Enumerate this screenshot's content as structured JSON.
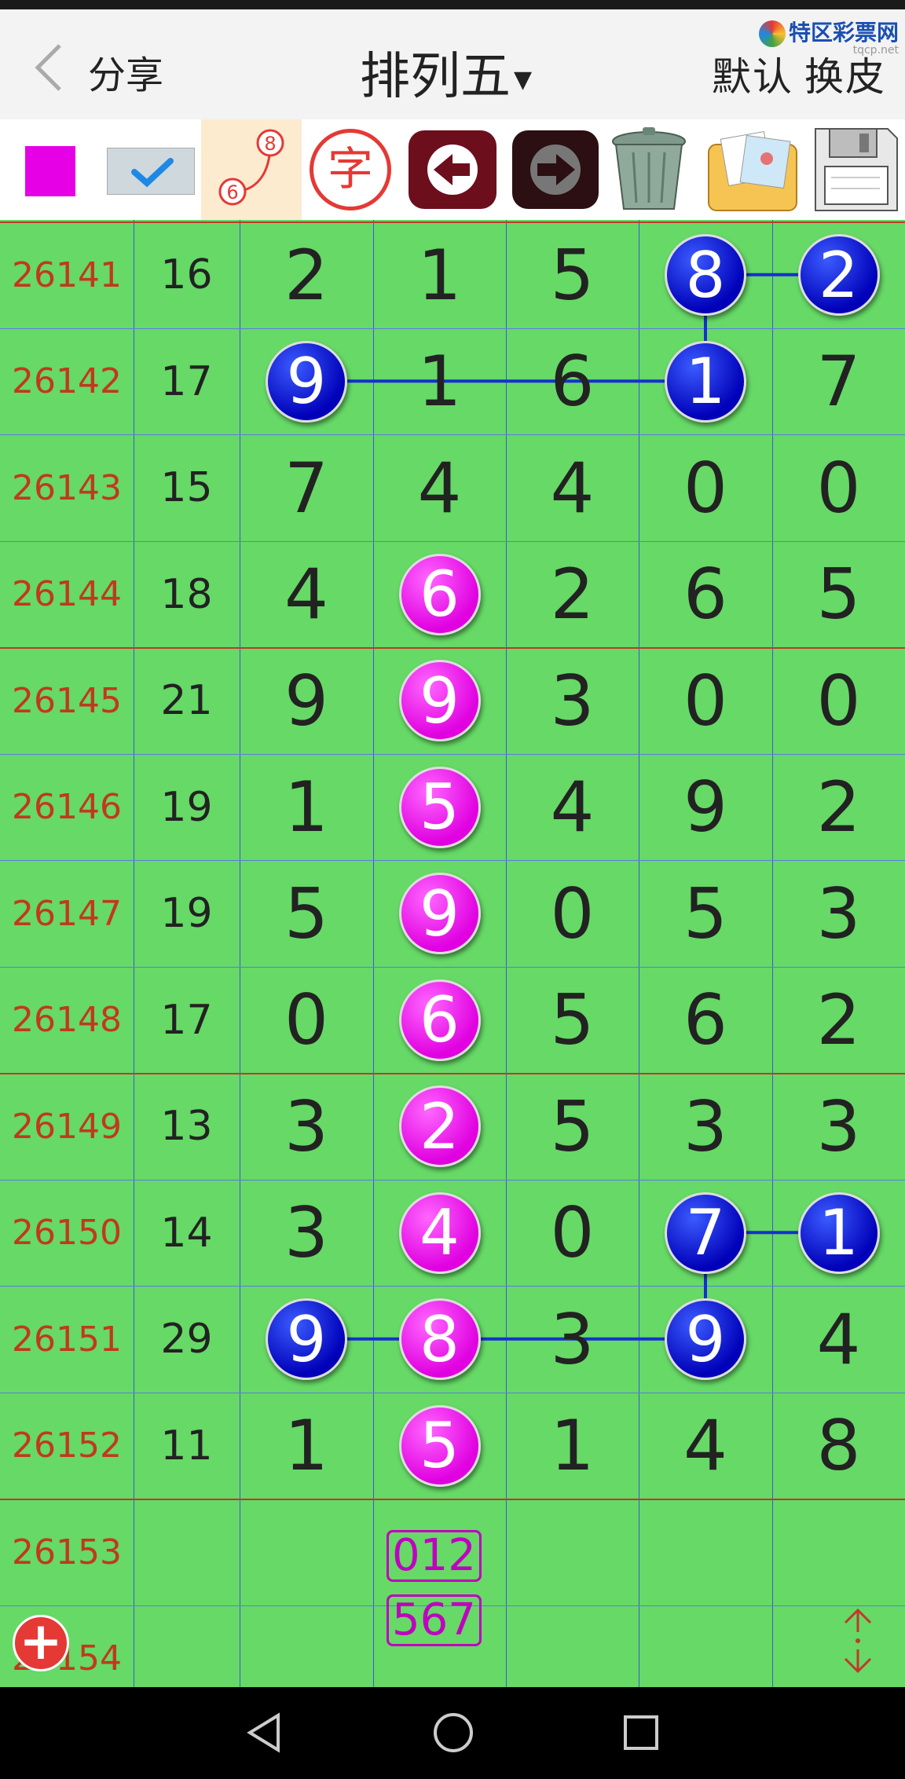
{
  "topbar": {
    "back_icon": "chevron-left-icon",
    "share_label": "分享",
    "title": "排列五",
    "dropdown_icon": "triangle-down-icon",
    "default_label": "默认",
    "skin_label": "换皮",
    "logo_text": "特区彩票网",
    "logo_url": "tqcp.net"
  },
  "toolbar": {
    "tools": [
      "color-swatch",
      "check-toggle",
      "number-link-tool",
      "character-tool",
      "arrow-left",
      "arrow-right",
      "trash",
      "photos",
      "floppy-disk"
    ],
    "char_label": "字",
    "num_top": "8",
    "num_bottom": "6",
    "swatch_color": "#e600e6"
  },
  "colors": {
    "grid_bg": "#66d966",
    "issue_text": "#c0391f",
    "blue_ball": "#0000b8",
    "magenta_ball": "#e000e0"
  },
  "rows": [
    {
      "issue": "26141",
      "sum": "16",
      "digits": [
        "2",
        "1",
        "5",
        "8",
        "2"
      ]
    },
    {
      "issue": "26142",
      "sum": "17",
      "digits": [
        "9",
        "1",
        "6",
        "1",
        "7"
      ]
    },
    {
      "issue": "26143",
      "sum": "15",
      "digits": [
        "7",
        "4",
        "4",
        "0",
        "0"
      ]
    },
    {
      "issue": "26144",
      "sum": "18",
      "digits": [
        "4",
        "6",
        "2",
        "6",
        "5"
      ]
    },
    {
      "issue": "26145",
      "sum": "21",
      "digits": [
        "9",
        "9",
        "3",
        "0",
        "0"
      ]
    },
    {
      "issue": "26146",
      "sum": "19",
      "digits": [
        "1",
        "5",
        "4",
        "9",
        "2"
      ]
    },
    {
      "issue": "26147",
      "sum": "19",
      "digits": [
        "5",
        "9",
        "0",
        "5",
        "3"
      ]
    },
    {
      "issue": "26148",
      "sum": "17",
      "digits": [
        "0",
        "6",
        "5",
        "6",
        "2"
      ]
    },
    {
      "issue": "26149",
      "sum": "13",
      "digits": [
        "3",
        "2",
        "5",
        "3",
        "3"
      ]
    },
    {
      "issue": "26150",
      "sum": "14",
      "digits": [
        "3",
        "4",
        "0",
        "7",
        "1"
      ]
    },
    {
      "issue": "26151",
      "sum": "29",
      "digits": [
        "9",
        "8",
        "3",
        "9",
        "4"
      ]
    },
    {
      "issue": "26152",
      "sum": "11",
      "digits": [
        "1",
        "5",
        "1",
        "4",
        "8"
      ]
    },
    {
      "issue": "26153",
      "sum": "",
      "digits": [
        "",
        "",
        "",
        "",
        ""
      ]
    },
    {
      "issue": "26154",
      "sum": "",
      "digits": [
        "",
        "",
        "",
        "",
        ""
      ]
    }
  ],
  "prediction": {
    "line1": "012",
    "line2": "567"
  },
  "add_button_label": "+",
  "scroll_icon": "scroll-updown-icon",
  "nav": {
    "back": "nav-back-icon",
    "home": "nav-home-icon",
    "recent": "nav-recent-icon"
  }
}
